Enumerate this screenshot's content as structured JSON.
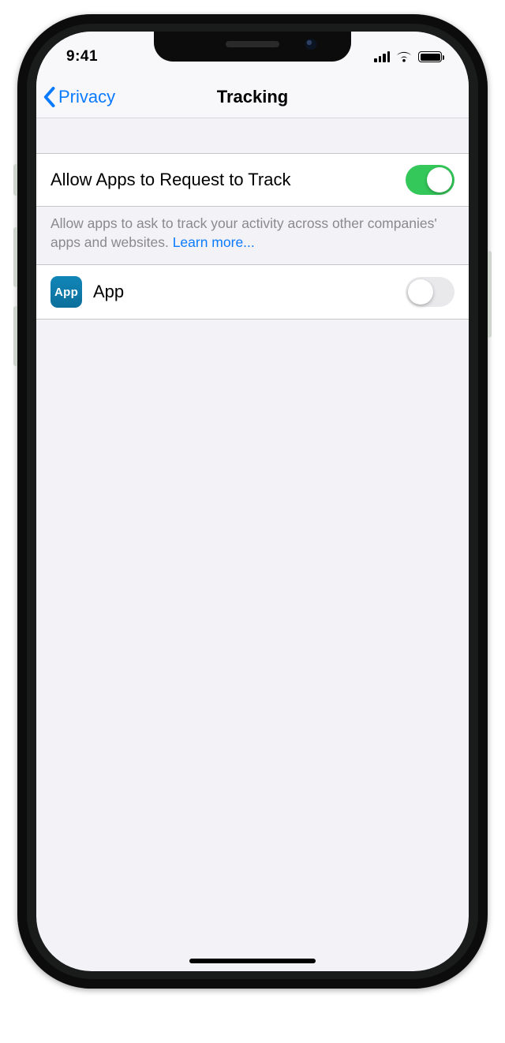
{
  "status": {
    "time": "9:41"
  },
  "nav": {
    "back_label": "Privacy",
    "title": "Tracking"
  },
  "rows": {
    "master": {
      "label": "Allow Apps to Request to Track",
      "value": true
    },
    "app": {
      "label": "App",
      "icon_text": "App",
      "value": false
    }
  },
  "footer": {
    "text_a": "Allow apps to ask to track your activity across other companies' apps and websites. ",
    "learn_more": "Learn more..."
  }
}
